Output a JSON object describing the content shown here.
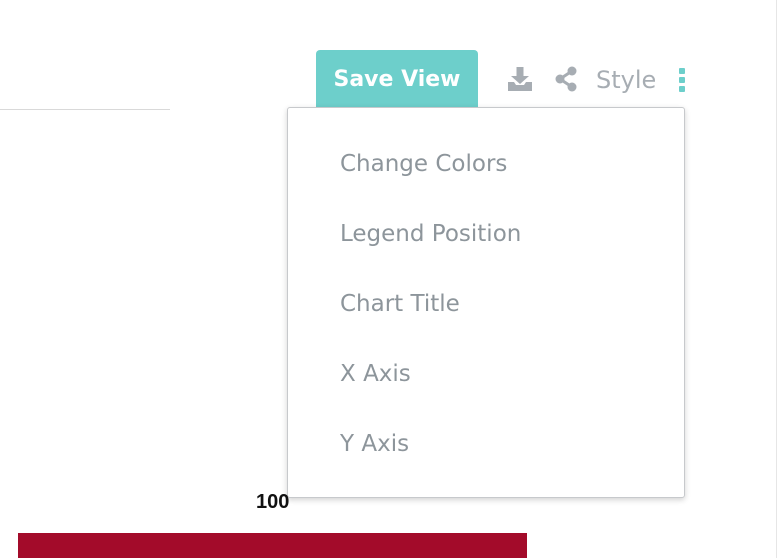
{
  "toolbar": {
    "save_view_label": "Save View",
    "style_label": "Style",
    "icons": {
      "download": "download-icon",
      "share": "share-icon",
      "more": "more-vertical-icon"
    }
  },
  "style_menu": {
    "items": [
      {
        "label": "Change Colors"
      },
      {
        "label": "Legend Position"
      },
      {
        "label": "Chart Title"
      },
      {
        "label": "X Axis"
      },
      {
        "label": "Y Axis"
      }
    ]
  },
  "chart_peek": {
    "data_label": "100",
    "bar_color": "#a30b2a"
  },
  "colors": {
    "accent": "#6dcfcb",
    "icon_gray": "#a7adb3",
    "menu_text": "#8d959b",
    "bar": "#a30b2a"
  }
}
